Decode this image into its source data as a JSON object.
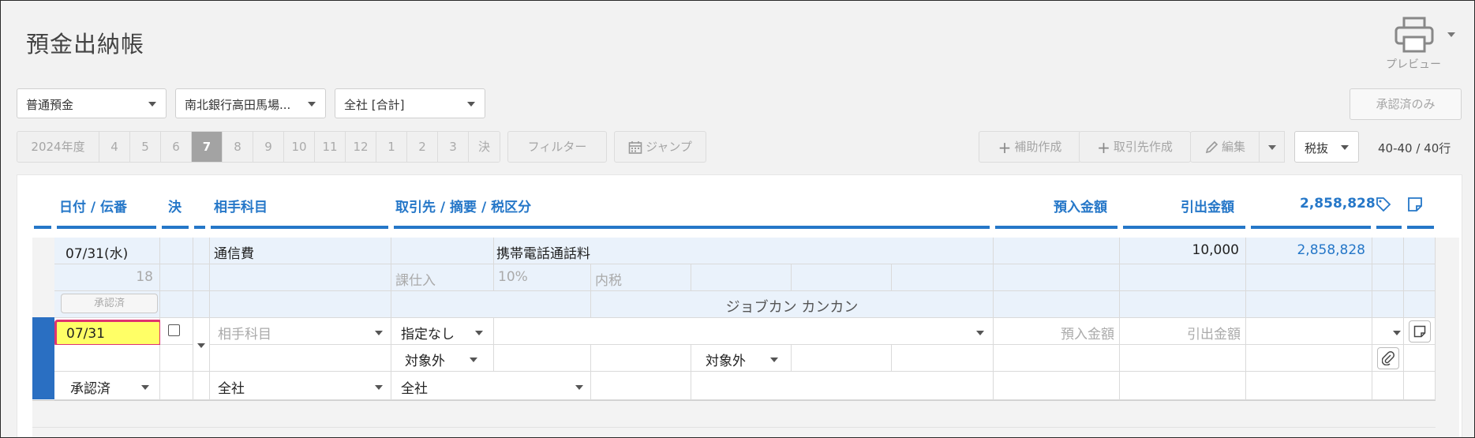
{
  "header": {
    "title": "預金出納帳",
    "preview_label": "プレビュー"
  },
  "filters": {
    "account": "普通預金",
    "bank": "南北銀行高田馬場...",
    "company": "全社 [合計]",
    "approved_only": "承認済のみ"
  },
  "toolbar": {
    "year": "2024年度",
    "months": [
      "4",
      "5",
      "6",
      "7",
      "8",
      "9",
      "10",
      "11",
      "12",
      "1",
      "2",
      "3",
      "決"
    ],
    "active_month": "7",
    "filter_label": "フィルター",
    "jump_label": "ジャンプ",
    "add_sub_label": "補助作成",
    "add_partner_label": "取引先作成",
    "edit_label": "編集",
    "tax_mode": "税抜",
    "row_count": "40-40 / 40行"
  },
  "columns": {
    "date_no": "日付 / 伝番",
    "settle": "決",
    "counter_account": "相手科目",
    "partner_memo_tax": "取引先 / 摘要 / 税区分",
    "deposit": "預入金額",
    "withdrawal": "引出金額",
    "balance": "2,858,828"
  },
  "entry": {
    "date": "07/31(水)",
    "slip_no": "18",
    "status": "承認済",
    "account": "通信費",
    "memo": "携帯電話通話料",
    "tax_category": "課仕入",
    "tax_rate": "10%",
    "tax_type": "内税",
    "partner": "ジョブカン カンカン",
    "withdrawal": "10,000",
    "balance": "2,858,828"
  },
  "form": {
    "date": "07/31",
    "account_placeholder": "相手科目",
    "partner_select": "指定なし",
    "tax_left": "対象外",
    "tax_right": "対象外",
    "deposit_placeholder": "預入金額",
    "withdrawal_placeholder": "引出金額",
    "status": "承認済",
    "dept_left": "全社",
    "dept_right": "全社"
  }
}
